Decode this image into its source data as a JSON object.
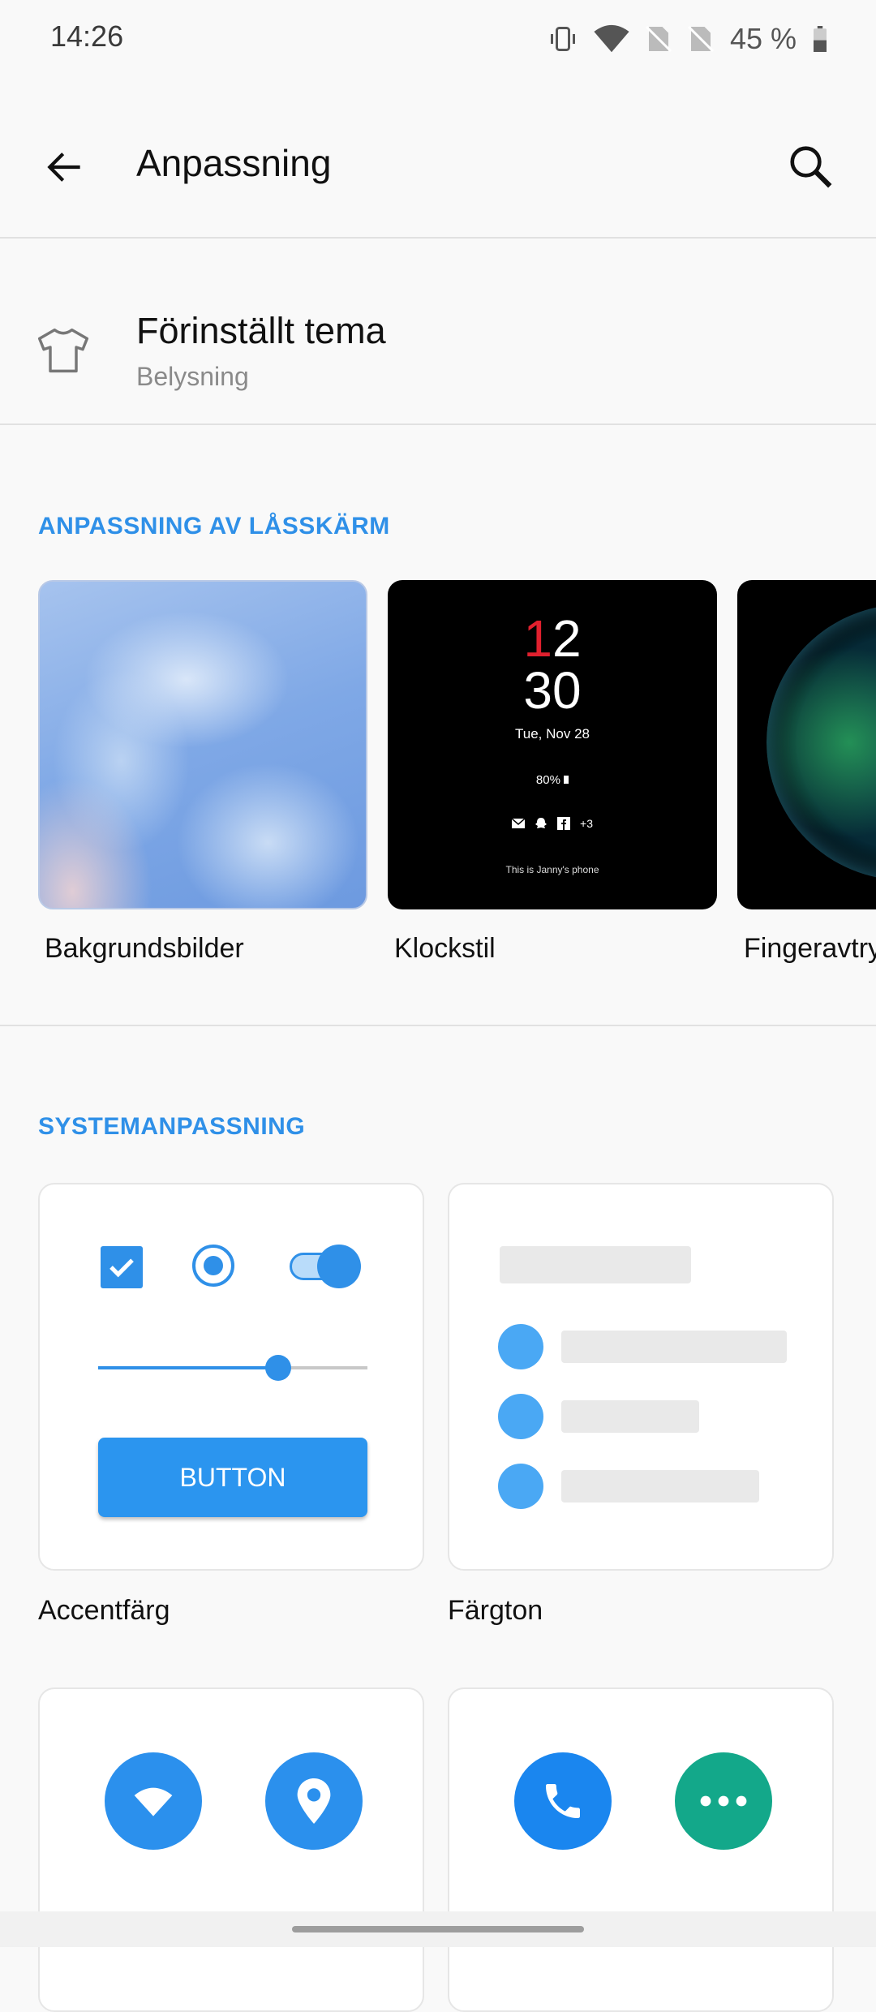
{
  "status_bar": {
    "time": "14:26",
    "battery_text": "45 %"
  },
  "topbar": {
    "title": "Anpassning"
  },
  "preset_theme": {
    "title": "Förinställt tema",
    "subtitle": "Belysning"
  },
  "lockscreen_section": {
    "heading": "ANPASSNING AV LÅSSKÄRM",
    "tiles": [
      {
        "label": "Bakgrundsbilder"
      },
      {
        "label": "Klockstil"
      },
      {
        "label": "Fingeravtry"
      }
    ],
    "clock_preview": {
      "hour_first": "1",
      "hour_second": "2",
      "minutes": "30",
      "date": "Tue, Nov 28",
      "battery": "80%",
      "notifications_more": "+3",
      "owner": "This is Janny's phone"
    }
  },
  "system_section": {
    "heading": "SYSTEMANPASSNING",
    "cards": [
      {
        "label": "Accentfärg",
        "button_label": "BUTTON"
      },
      {
        "label": "Färgton"
      }
    ]
  },
  "colors": {
    "accent": "#2f90e8",
    "accent_button": "#2b95ef",
    "teal": "#13a88a"
  },
  "slider": {
    "value_fraction": 0.67
  },
  "icons": {
    "status": [
      "vibrate-icon",
      "wifi-icon",
      "no-sim-icon",
      "no-sim-icon",
      "battery-icon"
    ],
    "topbar": [
      "back-arrow-icon",
      "search-icon"
    ],
    "preset_theme": "tshirt-icon",
    "bottom_cards": [
      "wifi-icon",
      "location-icon",
      "phone-icon",
      "more-icon"
    ]
  }
}
